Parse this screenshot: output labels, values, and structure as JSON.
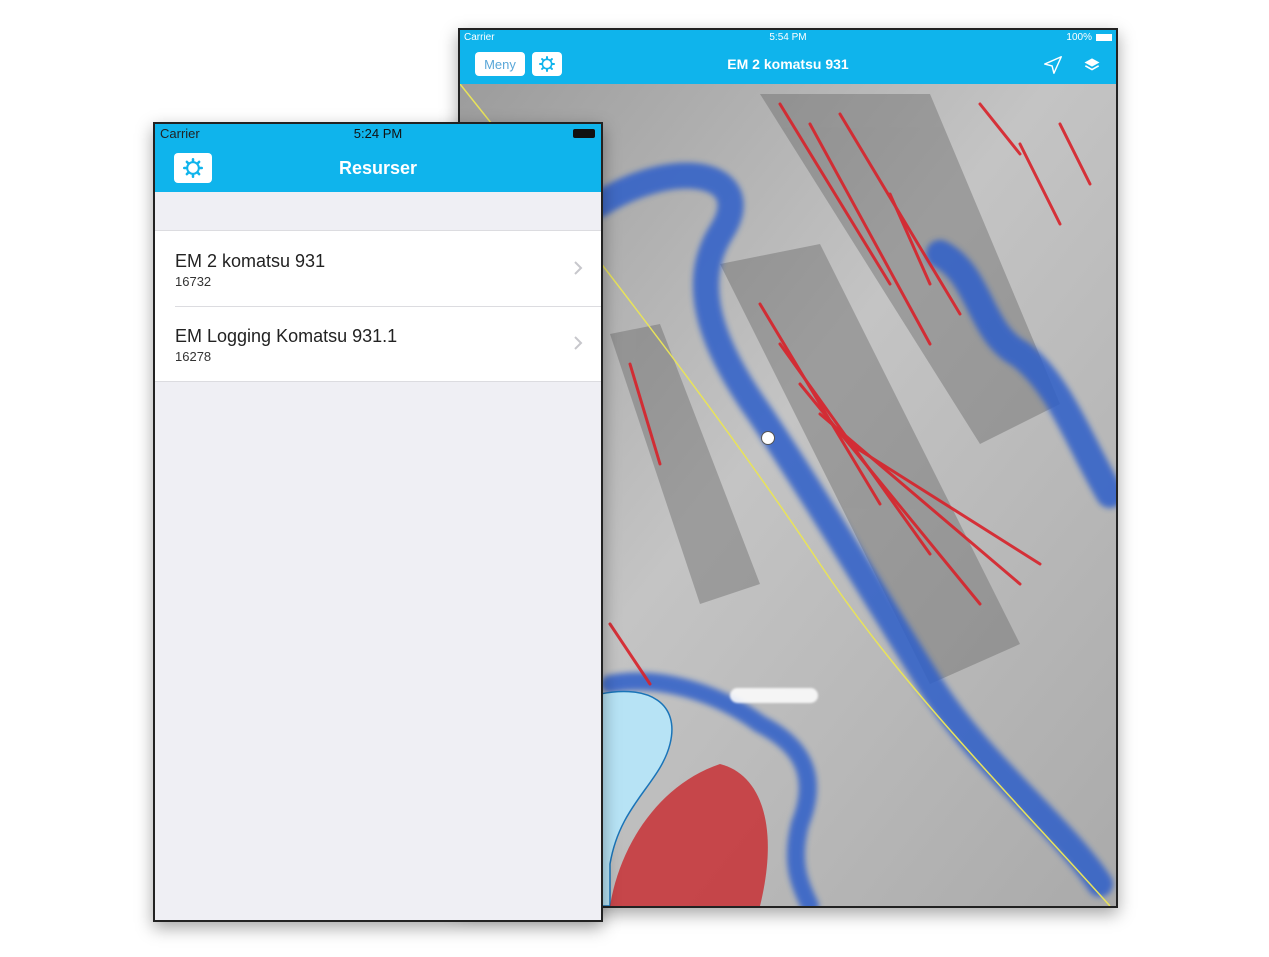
{
  "ipad": {
    "status": {
      "carrier": "Carrier",
      "time": "5:54 PM",
      "battery": "100%"
    },
    "navbar": {
      "meny_label": "Meny",
      "title": "EM 2 komatsu 931"
    },
    "map": {
      "place_label": ""
    }
  },
  "iphone": {
    "status": {
      "carrier": "Carrier",
      "time": "5:24 PM"
    },
    "navbar": {
      "title": "Resurser"
    },
    "list": [
      {
        "title": "EM 2 komatsu 931",
        "subtitle": "16732"
      },
      {
        "title": "EM Logging Komatsu 931.1",
        "subtitle": "16278"
      }
    ]
  },
  "colors": {
    "accent": "#0FB4EC",
    "list_background": "#EFEFF4",
    "map_relief": "#B8B8B8",
    "map_water": "#B7E3F5",
    "map_wet_zone": "#2E5FC9",
    "map_steep_slope": "#D8222A"
  }
}
